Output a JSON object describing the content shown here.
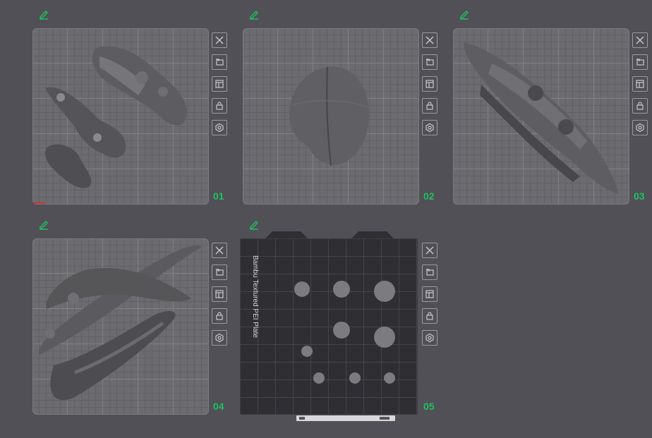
{
  "plates": [
    {
      "number": "01"
    },
    {
      "number": "02"
    },
    {
      "number": "03"
    },
    {
      "number": "04"
    },
    {
      "number": "05",
      "plate_type": "Bambu Textured PEI Plate"
    }
  ],
  "tool_icons": [
    "close-icon",
    "auto-orient-icon",
    "arrange-icon",
    "lock-icon",
    "settings-icon"
  ],
  "colors": {
    "background": "#505056",
    "plate": "#6c6c70",
    "accent_number": "#20c060",
    "model": "#5a5a5e",
    "dark_plate": "#2e2e33"
  }
}
